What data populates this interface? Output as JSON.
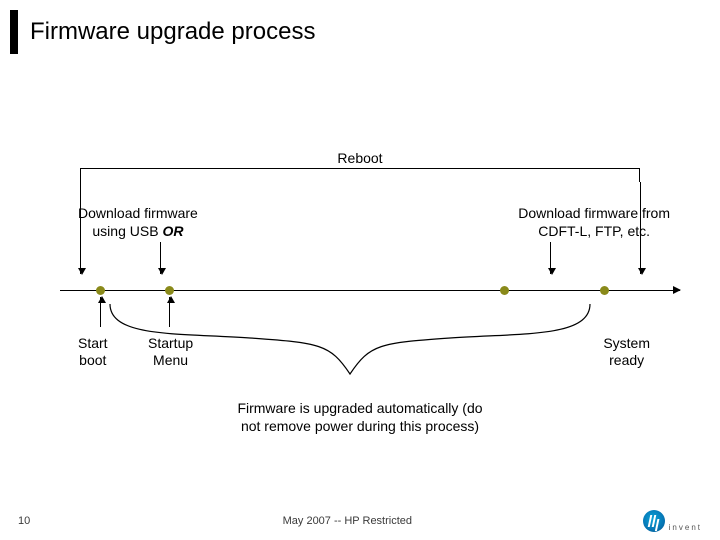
{
  "title": "Firmware upgrade process",
  "reboot_label": "Reboot",
  "download_usb": {
    "line1": "Download firmware",
    "line2_pre": "using USB ",
    "line2_em": "OR"
  },
  "download_ftp": {
    "line1": "Download firmware from",
    "line2": "CDFT-L, FTP, etc."
  },
  "events": {
    "start_boot": {
      "line1": "Start",
      "line2": "boot"
    },
    "startup_menu": {
      "line1": "Startup",
      "line2": "Menu"
    },
    "system_ready": {
      "line1": "System",
      "line2": "ready"
    }
  },
  "firmware_note": {
    "line1": "Firmware is upgraded automatically (do",
    "line2": "not remove power during this process)"
  },
  "footer": {
    "page_number": "10",
    "center": "May 2007 -- HP Restricted",
    "logo_text": "invent"
  },
  "colors": {
    "accent_bar": "#000000",
    "dot": "#8a8a1a",
    "hp_blue": "#0676b5"
  }
}
